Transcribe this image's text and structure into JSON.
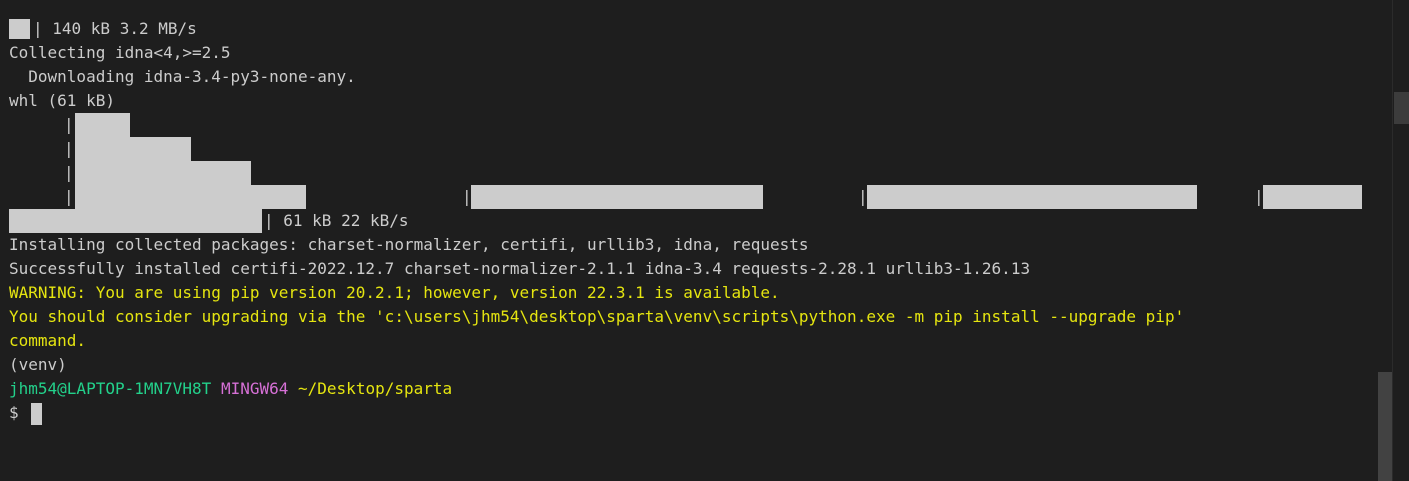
{
  "terminal": {
    "lines": {
      "l0": "140 kB 3.2 MB/s",
      "l1": "Collecting idna<4,>=2.5",
      "l2": "  Downloading idna-3.4-py3-none-any.",
      "l3": "whl (61 kB)",
      "l9": "61 kB 22 kB/s",
      "l10": "Installing collected packages: charset-normalizer, certifi, urllib3, idna, requests",
      "l11": "Successfully installed certifi-2022.12.7 charset-normalizer-2.1.1 idna-3.4 requests-2.28.1 urllib3-1.26.13",
      "l12": "WARNING: You are using pip version 20.2.1; however, version 22.3.1 is available.",
      "l13": "You should consider upgrading via the 'c:\\users\\jhm54\\desktop\\sparta\\venv\\scripts\\python.exe -m pip install --upgrade pip'",
      "l14": "command.",
      "l15": "(venv)",
      "prompt_user": "jhm54@LAPTOP-1MN7VH8T",
      "prompt_env": "MINGW64",
      "prompt_path": "~/Desktop/sparta",
      "prompt_symbol": "$"
    },
    "colors": {
      "background": "#1e1e1e",
      "foreground": "#cccccc",
      "warning": "#e5e510",
      "user": "#23d18b",
      "env": "#d670d6"
    }
  }
}
